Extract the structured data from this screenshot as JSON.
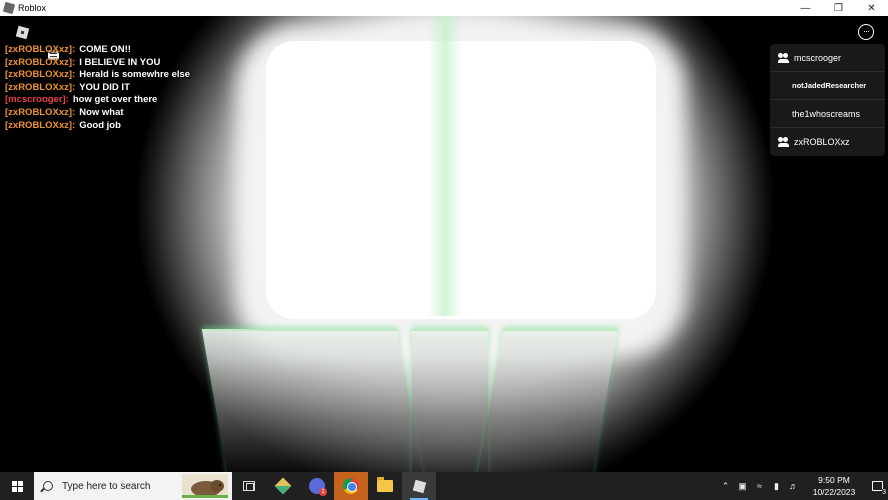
{
  "window": {
    "title": "Roblox",
    "controls": [
      "minimize-icon",
      "restore-icon",
      "close-icon"
    ]
  },
  "chat": {
    "messages": [
      {
        "name": "[zxROBLOXxz]:",
        "text": "COME ON!!",
        "color": "#f0932b"
      },
      {
        "name": "[zxROBLOXxz]:",
        "text": "I BELIEVE IN YOU",
        "color": "#f0932b"
      },
      {
        "name": "[zxROBLOXxz]:",
        "text": "Herald is somewhre else",
        "color": "#f0932b"
      },
      {
        "name": "[zxROBLOXxz]:",
        "text": "YOU DID IT",
        "color": "#f0932b"
      },
      {
        "name": "[mcscrooger]:",
        "text": "how get over there",
        "color": "#e8424b"
      },
      {
        "name": "[zxROBLOXxz]:",
        "text": "Now what",
        "color": "#f0932b"
      },
      {
        "name": "[zxROBLOXxz]:",
        "text": "Good job",
        "color": "#f0932b"
      }
    ]
  },
  "players": [
    {
      "name": "mcscrooger",
      "icon": "friends-icon"
    },
    {
      "name": "notJadedResearcher",
      "icon": ""
    },
    {
      "name": "the1whoscreams",
      "icon": ""
    },
    {
      "name": "zxROBLOXxz",
      "icon": "friends-icon"
    }
  ],
  "taskbar": {
    "search_placeholder": "Type here to search",
    "apps": [
      "task-view-icon",
      "kite-app-icon",
      "discord-icon",
      "chrome-icon",
      "file-explorer-icon",
      "roblox-icon"
    ],
    "discord_badge": "1",
    "clock_time": "9:50 PM",
    "clock_date": "10/22/2023",
    "notifications_count": "3"
  }
}
